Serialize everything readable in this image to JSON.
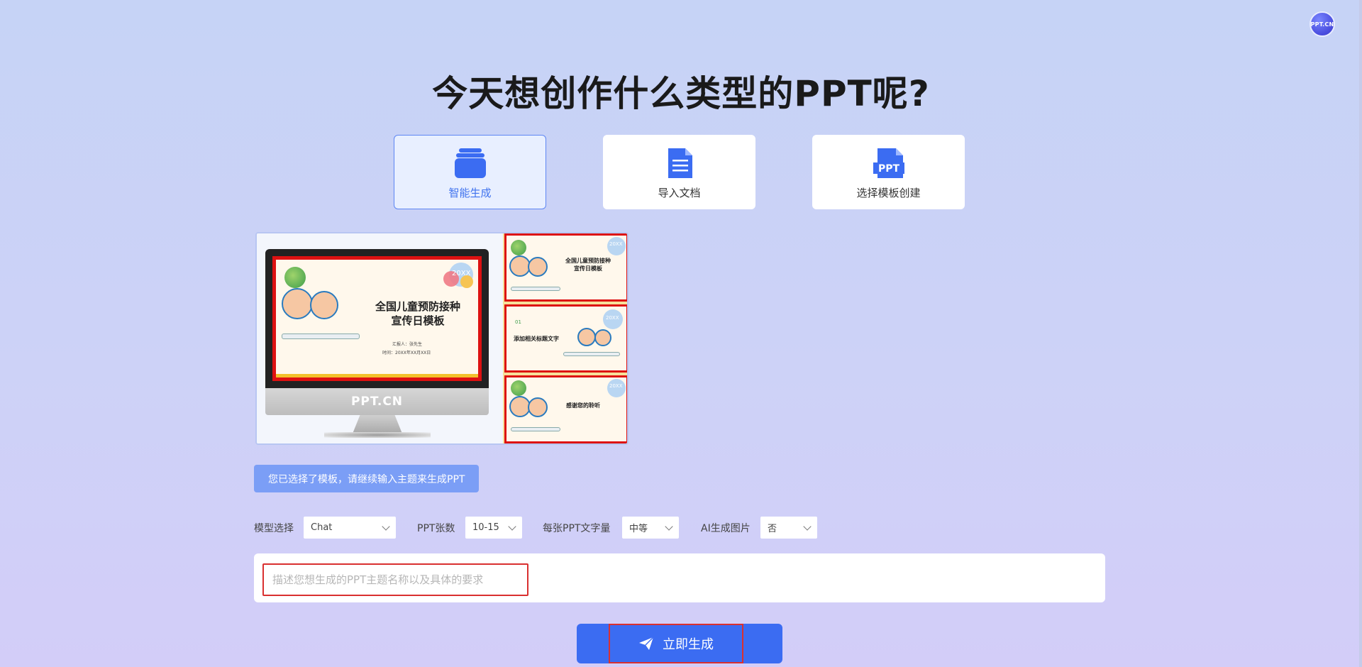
{
  "header": {
    "avatar_text": "PPT.CN"
  },
  "page_title": "今天想创作什么类型的PPT呢?",
  "modes": [
    {
      "label": "智能生成",
      "icon": "stack-icon",
      "active": true
    },
    {
      "label": "导入文档",
      "icon": "document-icon",
      "active": false
    },
    {
      "label": "选择模板创建",
      "icon": "ppt-file-icon",
      "active": false
    }
  ],
  "template_preview": {
    "main_title_line1": "全国儿童预防接种",
    "main_title_line2": "宣传日模板",
    "badge": "20XX",
    "meta_line1": "汇报人：张先生",
    "meta_line2": "时间：20XX年XX月XX日",
    "monitor_brand": "PPT.CN",
    "thumbs": [
      {
        "title": "全国儿童预防接种\n宣传日模板",
        "badge": "20XX"
      },
      {
        "number": "01",
        "title": "添加相关标题文字",
        "badge": "20XX"
      },
      {
        "title": "感谢您的聆听",
        "badge": "20XX"
      }
    ]
  },
  "hint": "您已选择了模板，请继续输入主题来生成PPT",
  "options": {
    "model_label": "模型选择",
    "model_value": "Chat",
    "count_label": "PPT张数",
    "count_value": "10-15",
    "words_label": "每张PPT文字量",
    "words_value": "中等",
    "ai_image_label": "AI生成图片",
    "ai_image_value": "否"
  },
  "prompt": {
    "placeholder": "描述您想生成的PPT主题名称以及具体的要求",
    "value": ""
  },
  "generate_button": "立即生成",
  "colors": {
    "accent": "#3b6cf2",
    "highlight": "#d93030"
  }
}
